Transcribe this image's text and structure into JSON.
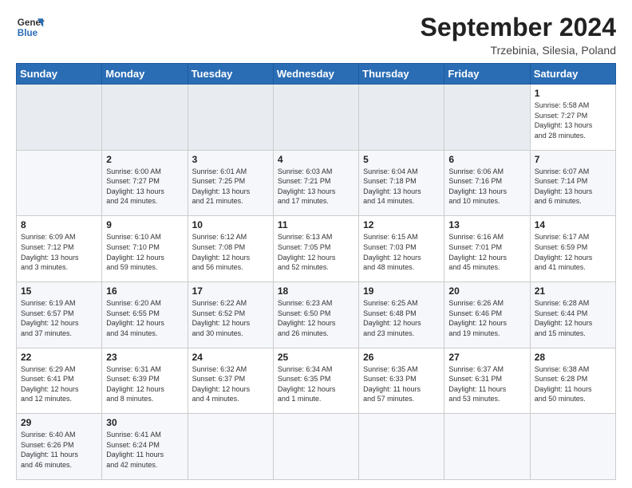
{
  "header": {
    "logo_line1": "General",
    "logo_line2": "Blue",
    "title": "September 2024",
    "subtitle": "Trzebinia, Silesia, Poland"
  },
  "calendar": {
    "days_of_week": [
      "Sunday",
      "Monday",
      "Tuesday",
      "Wednesday",
      "Thursday",
      "Friday",
      "Saturday"
    ],
    "weeks": [
      [
        {
          "day": null,
          "info": ""
        },
        {
          "day": null,
          "info": ""
        },
        {
          "day": null,
          "info": ""
        },
        {
          "day": null,
          "info": ""
        },
        {
          "day": null,
          "info": ""
        },
        {
          "day": null,
          "info": ""
        },
        {
          "day": "1",
          "info": "Sunrise: 5:58 AM\nSunset: 7:27 PM\nDaylight: 13 hours\nand 28 minutes."
        }
      ],
      [
        {
          "day": "2",
          "info": "Sunrise: 6:00 AM\nSunset: 7:27 PM\nDaylight: 13 hours\nand 24 minutes."
        },
        {
          "day": "3",
          "info": "Sunrise: 6:01 AM\nSunset: 7:25 PM\nDaylight: 13 hours\nand 21 minutes."
        },
        {
          "day": "4",
          "info": "Sunrise: 6:03 AM\nSunset: 7:21 PM\nDaylight: 13 hours\nand 17 minutes."
        },
        {
          "day": "5",
          "info": "Sunrise: 6:04 AM\nSunset: 7:18 PM\nDaylight: 13 hours\nand 14 minutes."
        },
        {
          "day": "6",
          "info": "Sunrise: 6:06 AM\nSunset: 7:16 PM\nDaylight: 13 hours\nand 10 minutes."
        },
        {
          "day": "7",
          "info": "Sunrise: 6:07 AM\nSunset: 7:14 PM\nDaylight: 13 hours\nand 6 minutes."
        }
      ],
      [
        {
          "day": "8",
          "info": "Sunrise: 6:09 AM\nSunset: 7:12 PM\nDaylight: 13 hours\nand 3 minutes."
        },
        {
          "day": "9",
          "info": "Sunrise: 6:10 AM\nSunset: 7:10 PM\nDaylight: 12 hours\nand 59 minutes."
        },
        {
          "day": "10",
          "info": "Sunrise: 6:12 AM\nSunset: 7:08 PM\nDaylight: 12 hours\nand 56 minutes."
        },
        {
          "day": "11",
          "info": "Sunrise: 6:13 AM\nSunset: 7:05 PM\nDaylight: 12 hours\nand 52 minutes."
        },
        {
          "day": "12",
          "info": "Sunrise: 6:15 AM\nSunset: 7:03 PM\nDaylight: 12 hours\nand 48 minutes."
        },
        {
          "day": "13",
          "info": "Sunrise: 6:16 AM\nSunset: 7:01 PM\nDaylight: 12 hours\nand 45 minutes."
        },
        {
          "day": "14",
          "info": "Sunrise: 6:17 AM\nSunset: 6:59 PM\nDaylight: 12 hours\nand 41 minutes."
        }
      ],
      [
        {
          "day": "15",
          "info": "Sunrise: 6:19 AM\nSunset: 6:57 PM\nDaylight: 12 hours\nand 37 minutes."
        },
        {
          "day": "16",
          "info": "Sunrise: 6:20 AM\nSunset: 6:55 PM\nDaylight: 12 hours\nand 34 minutes."
        },
        {
          "day": "17",
          "info": "Sunrise: 6:22 AM\nSunset: 6:52 PM\nDaylight: 12 hours\nand 30 minutes."
        },
        {
          "day": "18",
          "info": "Sunrise: 6:23 AM\nSunset: 6:50 PM\nDaylight: 12 hours\nand 26 minutes."
        },
        {
          "day": "19",
          "info": "Sunrise: 6:25 AM\nSunset: 6:48 PM\nDaylight: 12 hours\nand 23 minutes."
        },
        {
          "day": "20",
          "info": "Sunrise: 6:26 AM\nSunset: 6:46 PM\nDaylight: 12 hours\nand 19 minutes."
        },
        {
          "day": "21",
          "info": "Sunrise: 6:28 AM\nSunset: 6:44 PM\nDaylight: 12 hours\nand 15 minutes."
        }
      ],
      [
        {
          "day": "22",
          "info": "Sunrise: 6:29 AM\nSunset: 6:41 PM\nDaylight: 12 hours\nand 12 minutes."
        },
        {
          "day": "23",
          "info": "Sunrise: 6:31 AM\nSunset: 6:39 PM\nDaylight: 12 hours\nand 8 minutes."
        },
        {
          "day": "24",
          "info": "Sunrise: 6:32 AM\nSunset: 6:37 PM\nDaylight: 12 hours\nand 4 minutes."
        },
        {
          "day": "25",
          "info": "Sunrise: 6:34 AM\nSunset: 6:35 PM\nDaylight: 12 hours\nand 1 minute."
        },
        {
          "day": "26",
          "info": "Sunrise: 6:35 AM\nSunset: 6:33 PM\nDaylight: 11 hours\nand 57 minutes."
        },
        {
          "day": "27",
          "info": "Sunrise: 6:37 AM\nSunset: 6:31 PM\nDaylight: 11 hours\nand 53 minutes."
        },
        {
          "day": "28",
          "info": "Sunrise: 6:38 AM\nSunset: 6:28 PM\nDaylight: 11 hours\nand 50 minutes."
        }
      ],
      [
        {
          "day": "29",
          "info": "Sunrise: 6:40 AM\nSunset: 6:26 PM\nDaylight: 11 hours\nand 46 minutes."
        },
        {
          "day": "30",
          "info": "Sunrise: 6:41 AM\nSunset: 6:24 PM\nDaylight: 11 hours\nand 42 minutes."
        },
        {
          "day": null,
          "info": ""
        },
        {
          "day": null,
          "info": ""
        },
        {
          "day": null,
          "info": ""
        },
        {
          "day": null,
          "info": ""
        },
        {
          "day": null,
          "info": ""
        }
      ]
    ]
  }
}
